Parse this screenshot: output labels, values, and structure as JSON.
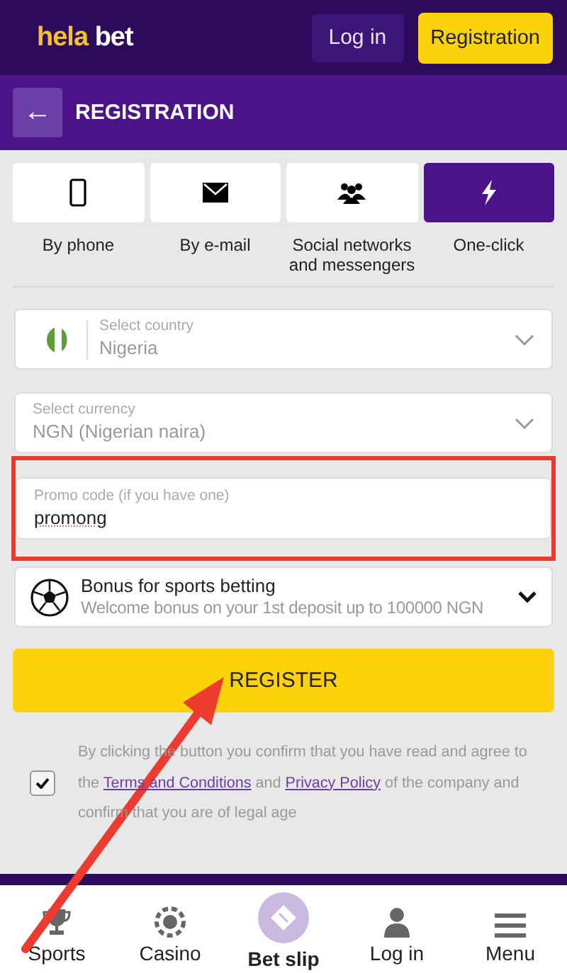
{
  "header": {
    "logo": {
      "part1": "hela",
      "part2": "bet"
    },
    "login_button": "Log in",
    "registration_button": "Registration"
  },
  "page_title": {
    "back": "←",
    "title": "REGISTRATION"
  },
  "methods": [
    {
      "label": "By phone",
      "kind": "phone",
      "selected": false
    },
    {
      "label": "By e-mail",
      "kind": "email",
      "selected": false
    },
    {
      "label": "Social networks and messengers",
      "kind": "social",
      "selected": false
    },
    {
      "label": "One-click",
      "kind": "bolt",
      "selected": true
    }
  ],
  "country": {
    "label": "Select country",
    "value": "Nigeria"
  },
  "currency": {
    "label": "Select currency",
    "value": "NGN  (Nigerian naira)"
  },
  "promo": {
    "label": "Promo code (if you have one)",
    "value": "promong",
    "highlighted": true
  },
  "bonus": {
    "title": "Bonus for sports betting",
    "subtitle": "Welcome bonus on your 1st deposit up to 100000 NGN"
  },
  "register_button": "REGISTER",
  "consent": {
    "checked": true,
    "before": "By clicking the button you confirm that you have read and agree to the",
    "link1": "Terms and Conditions",
    "middle": "and",
    "link2": "Privacy Policy",
    "after": "of the company and confirm that you are of legal age"
  },
  "bottom_nav": [
    {
      "label": "Sports",
      "kind": "trophy"
    },
    {
      "label": "Casino",
      "kind": "chip"
    },
    {
      "label": "Bet slip",
      "kind": "ticket"
    },
    {
      "label": "Log in",
      "kind": "person"
    },
    {
      "label": "Menu",
      "kind": "menu"
    }
  ],
  "annotation": {
    "arrow": true
  }
}
